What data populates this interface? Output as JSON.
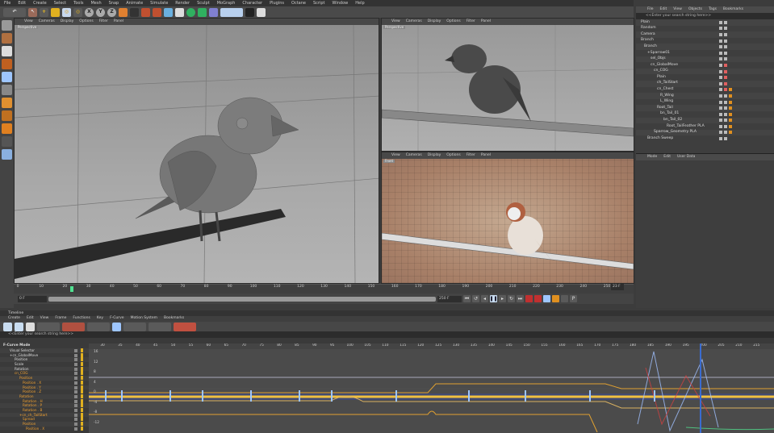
{
  "menu": [
    "File",
    "Edit",
    "Create",
    "Select",
    "Tools",
    "Mesh",
    "Snap",
    "Animate",
    "Simulate",
    "Render",
    "Sculpt",
    "MoGraph",
    "Character",
    "Plugins",
    "Octane",
    "Script",
    "Window",
    "Help"
  ],
  "axis_buttons": [
    "X",
    "Y",
    "Z"
  ],
  "viewport_menu": [
    "View",
    "Cameras",
    "Display",
    "Options",
    "Filter",
    "Panel"
  ],
  "viewports": [
    {
      "label": "Perspective"
    },
    {
      "label": "Perspective"
    },
    {
      "label": "Front"
    }
  ],
  "ruler_ticks": [
    "0",
    "10",
    "20",
    "30",
    "40",
    "50",
    "60",
    "70",
    "80",
    "90",
    "100",
    "110",
    "120",
    "130",
    "140",
    "150",
    "160",
    "170",
    "180",
    "190",
    "200",
    "210",
    "220",
    "230",
    "240",
    "250"
  ],
  "transport": {
    "current_frame": "0 F",
    "end_frame": "250 F",
    "frame_readout": "23 F"
  },
  "object_manager": {
    "menu": [
      "File",
      "Edit",
      "View",
      "Objects",
      "Tags",
      "Bookmarks"
    ],
    "search_placeholder": "<<Enter your search string here>>",
    "objects": [
      "Plain",
      "Random",
      "Camera",
      "Branch",
      "Branch",
      "+Sparrow01",
      "sel_Objs",
      "cn_GlobalMove",
      "cn_COG",
      "Plain",
      "ch_TailStart",
      "cn_Chest",
      "R_Wing",
      "L_Wing",
      "Root_Tail",
      "bn_Tail_01",
      "bn_Tail_02",
      "Root_TailFeather PLA",
      "Sparrow_Geometry PLA",
      "Branch Sweep"
    ]
  },
  "attributes": {
    "menu": [
      "Mode",
      "Edit",
      "User Data"
    ]
  },
  "timeline": {
    "title": "Timeline",
    "menu": [
      "Create",
      "Edit",
      "View",
      "Frame",
      "Functions",
      "Key",
      "F-Curve",
      "Motion System",
      "Bookmarks"
    ],
    "search_placeholder": "<<Enter your search string here>>",
    "mode": "F-Curve Mode",
    "tracks": [
      "Visual Selector",
      "+cn_GlobalMove",
      "Position",
      "Scale",
      "Rotation",
      "cn_COG",
      "Position",
      "Position . X",
      "Position . Y",
      "Position . Z",
      "Rotation",
      "Rotation . H",
      "Rotation . P",
      "Rotation . B",
      "+cn_ch_TailStart",
      "Spread",
      "Position",
      "Position . X"
    ],
    "frame_ticks": [
      "30",
      "35",
      "40",
      "45",
      "50",
      "55",
      "60",
      "65",
      "70",
      "75",
      "80",
      "85",
      "90",
      "95",
      "100",
      "105",
      "110",
      "115",
      "120",
      "125",
      "130",
      "135",
      "140",
      "145",
      "150",
      "155",
      "160",
      "165",
      "170",
      "175",
      "180",
      "185",
      "190",
      "195",
      "200",
      "205",
      "210",
      "215"
    ],
    "y_ticks": [
      "16",
      "12",
      "8",
      "4",
      "0",
      "-4",
      "-8",
      "-12"
    ]
  },
  "colors": {
    "accent": "#f0a030",
    "keyframe": "#9ec6ff",
    "current": "#3a6cd0"
  }
}
